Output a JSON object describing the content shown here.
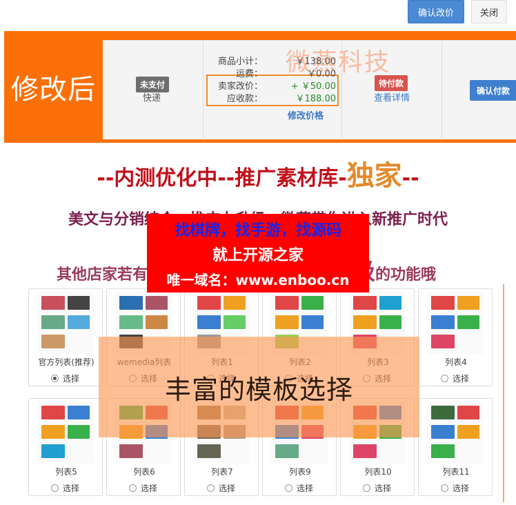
{
  "top_buttons": {
    "confirm_price": "确认改价",
    "close": "关闭"
  },
  "strip": {
    "label": "修改后",
    "watermark": "微燕科技",
    "badge_unpaid": "未支付",
    "shipping": "快递",
    "prices": [
      {
        "label": "商品小计：",
        "value": "￥138.00"
      },
      {
        "label": "运费：",
        "value": "￥0.00"
      },
      {
        "label": "卖家改价：",
        "value": "+ ￥50.00"
      },
      {
        "label": "应收款：",
        "value": "￥188.00"
      }
    ],
    "modify_price": "修改价格",
    "badge_pending": "待付款",
    "view_detail": "查看详情",
    "confirm_payment": "确认付款"
  },
  "headings": {
    "line1_a": "--内测优化中--",
    "line1_b": "推广素材库-",
    "line1_c": "独家",
    "line1_d": "--",
    "line2": "美文与分销结合，推广力升级，微燕带你进入新推广时代",
    "line3_a": "其他店家若有",
    "line3_b": "顶级",
    "line3_c": "的功能哦"
  },
  "ad": {
    "line1": "找棋牌，找手游，找源码",
    "line2": "就上开源之家",
    "line3": "唯一域名：www.enboo.cn"
  },
  "templates_overlay": "丰富的模板选择",
  "select_label": "选择",
  "templates": [
    {
      "name": "官方列表(推荐)",
      "checked": true
    },
    {
      "name": "wemedia列表",
      "checked": false
    },
    {
      "name": "列表1",
      "checked": false
    },
    {
      "name": "列表2",
      "checked": false
    },
    {
      "name": "列表3",
      "checked": false
    },
    {
      "name": "列表4",
      "checked": false
    },
    {
      "name": "列表5",
      "checked": false
    },
    {
      "name": "列表6",
      "checked": false
    },
    {
      "name": "列表7",
      "checked": false
    },
    {
      "name": "列表9",
      "checked": false
    },
    {
      "name": "列表10",
      "checked": false
    },
    {
      "name": "列表11",
      "checked": false
    }
  ],
  "colors": {
    "orange": "#fb7006",
    "blue": "#4a8ad4",
    "red": "#ff0000"
  }
}
